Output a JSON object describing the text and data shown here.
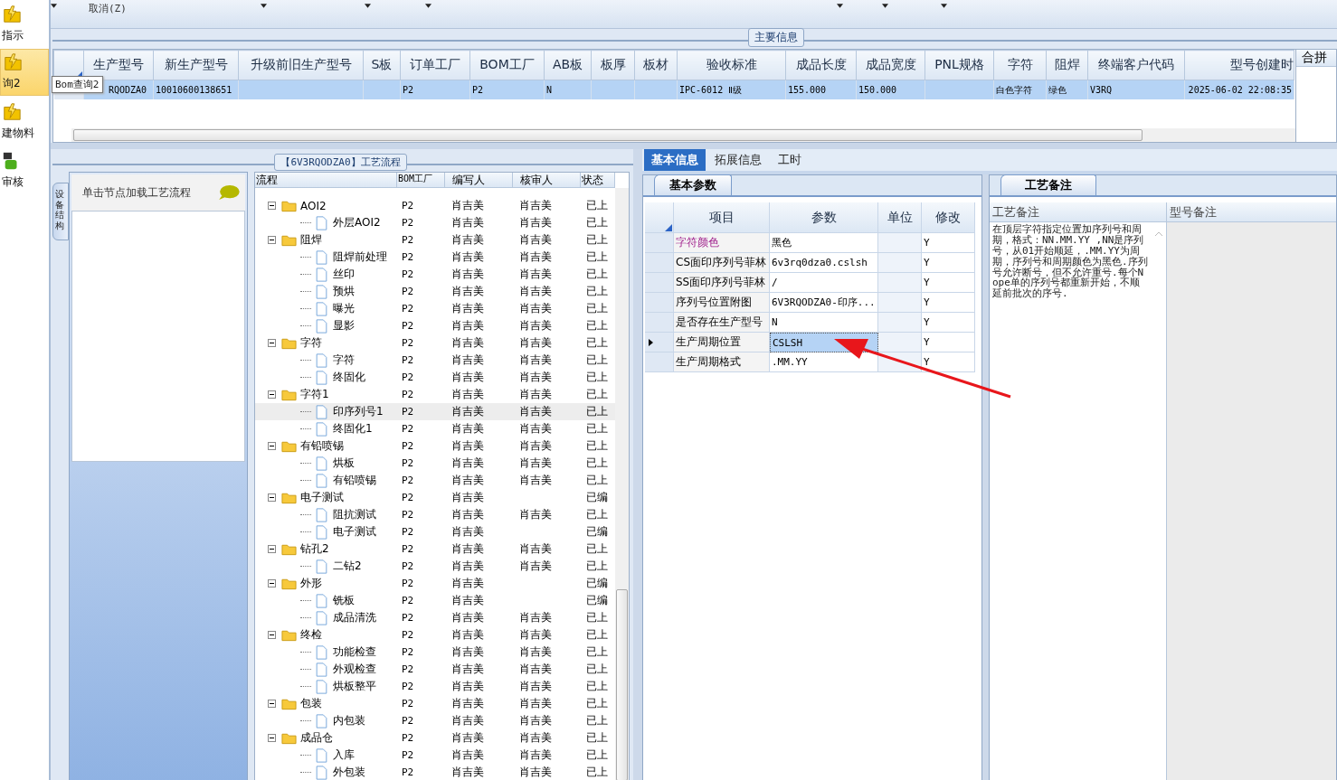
{
  "nav": [
    {
      "label": "指示",
      "selected": false
    },
    {
      "label": "询2",
      "selected": true
    },
    {
      "label": "建物料",
      "selected": false
    },
    {
      "label": "审核",
      "selected": false
    }
  ],
  "tooltip": "Bom查询2",
  "toolbar": {
    "cancel": "取消(Z)"
  },
  "main_info": {
    "title": "主要信息",
    "side_column": "合拼",
    "columns": [
      "生产型号",
      "新生产型号",
      "升级前旧生产型号",
      "S板",
      "订单工厂",
      "BOM工厂",
      "AB板",
      "板厚",
      "板材",
      "验收标准",
      "成品长度",
      "成品宽度",
      "PNL规格",
      "字符",
      "阻焊",
      "终端客户代码",
      "型号创建时"
    ],
    "rows": [
      {
        "selected": true,
        "cells": [
          "RQODZA0",
          "10010600138651",
          null,
          null,
          "P2",
          "P2",
          "N",
          null,
          null,
          "IPC-6012 Ⅱ级",
          "155.000",
          "150.000",
          null,
          "白色字符",
          "绿色",
          "V3RQ",
          "2025-06-02 22:08:35"
        ]
      }
    ]
  },
  "process": {
    "title": "【6V3RQODZA0】工艺流程",
    "side_tab": "设备结构",
    "hint": "单击节点加载工艺流程",
    "columns": [
      "流程",
      "BOM工厂",
      "编写人",
      "核审人",
      "状态"
    ],
    "tree": [
      {
        "name": "AOI2",
        "bom": "P2",
        "writer": "肖吉美",
        "reviewer": "肖吉美",
        "status": "已上",
        "expanded": true,
        "selected": false,
        "children": [
          {
            "name": "外层AOI2",
            "bom": "P2",
            "writer": "肖吉美",
            "reviewer": "肖吉美",
            "status": "已上",
            "selected": false
          }
        ]
      },
      {
        "name": "阻焊",
        "bom": "P2",
        "writer": "肖吉美",
        "reviewer": "肖吉美",
        "status": "已上",
        "expanded": true,
        "selected": false,
        "children": [
          {
            "name": "阻焊前处理",
            "bom": "P2",
            "writer": "肖吉美",
            "reviewer": "肖吉美",
            "status": "已上",
            "selected": false
          },
          {
            "name": "丝印",
            "bom": "P2",
            "writer": "肖吉美",
            "reviewer": "肖吉美",
            "status": "已上",
            "selected": false
          },
          {
            "name": "预烘",
            "bom": "P2",
            "writer": "肖吉美",
            "reviewer": "肖吉美",
            "status": "已上",
            "selected": false
          },
          {
            "name": "曝光",
            "bom": "P2",
            "writer": "肖吉美",
            "reviewer": "肖吉美",
            "status": "已上",
            "selected": false
          },
          {
            "name": "显影",
            "bom": "P2",
            "writer": "肖吉美",
            "reviewer": "肖吉美",
            "status": "已上",
            "selected": false
          }
        ]
      },
      {
        "name": "字符",
        "bom": "P2",
        "writer": "肖吉美",
        "reviewer": "肖吉美",
        "status": "已上",
        "expanded": true,
        "selected": false,
        "children": [
          {
            "name": "字符",
            "bom": "P2",
            "writer": "肖吉美",
            "reviewer": "肖吉美",
            "status": "已上",
            "selected": false
          },
          {
            "name": "终固化",
            "bom": "P2",
            "writer": "肖吉美",
            "reviewer": "肖吉美",
            "status": "已上",
            "selected": false
          }
        ]
      },
      {
        "name": "字符1",
        "bom": "P2",
        "writer": "肖吉美",
        "reviewer": "肖吉美",
        "status": "已上",
        "expanded": true,
        "selected": false,
        "children": [
          {
            "name": "印序列号1",
            "bom": "P2",
            "writer": "肖吉美",
            "reviewer": "肖吉美",
            "status": "已上",
            "selected": true
          },
          {
            "name": "终固化1",
            "bom": "P2",
            "writer": "肖吉美",
            "reviewer": "肖吉美",
            "status": "已上",
            "selected": false
          }
        ]
      },
      {
        "name": "有铅喷锡",
        "bom": "P2",
        "writer": "肖吉美",
        "reviewer": "肖吉美",
        "status": "已上",
        "expanded": true,
        "selected": false,
        "children": [
          {
            "name": "烘板",
            "bom": "P2",
            "writer": "肖吉美",
            "reviewer": "肖吉美",
            "status": "已上",
            "selected": false
          },
          {
            "name": "有铅喷锡",
            "bom": "P2",
            "writer": "肖吉美",
            "reviewer": "肖吉美",
            "status": "已上",
            "selected": false
          }
        ]
      },
      {
        "name": "电子测试",
        "bom": "P2",
        "writer": "肖吉美",
        "status": "已编",
        "expanded": true,
        "selected": false,
        "children": [
          {
            "name": "阻抗测试",
            "bom": "P2",
            "writer": "肖吉美",
            "reviewer": "肖吉美",
            "status": "已上",
            "selected": false
          },
          {
            "name": "电子测试",
            "bom": "P2",
            "writer": "肖吉美",
            "status": "已编",
            "selected": false
          }
        ]
      },
      {
        "name": "钻孔2",
        "bom": "P2",
        "writer": "肖吉美",
        "reviewer": "肖吉美",
        "status": "已上",
        "expanded": true,
        "selected": false,
        "children": [
          {
            "name": "二钻2",
            "bom": "P2",
            "writer": "肖吉美",
            "reviewer": "肖吉美",
            "status": "已上",
            "selected": false
          }
        ]
      },
      {
        "name": "外形",
        "bom": "P2",
        "writer": "肖吉美",
        "status": "已编",
        "expanded": true,
        "selected": false,
        "children": [
          {
            "name": "铣板",
            "bom": "P2",
            "writer": "肖吉美",
            "status": "已编",
            "selected": false
          },
          {
            "name": "成品清洗",
            "bom": "P2",
            "writer": "肖吉美",
            "reviewer": "肖吉美",
            "status": "已上",
            "selected": false
          }
        ]
      },
      {
        "name": "终检",
        "bom": "P2",
        "writer": "肖吉美",
        "reviewer": "肖吉美",
        "status": "已上",
        "expanded": true,
        "selected": false,
        "children": [
          {
            "name": "功能检查",
            "bom": "P2",
            "writer": "肖吉美",
            "reviewer": "肖吉美",
            "status": "已上",
            "selected": false
          },
          {
            "name": "外观检查",
            "bom": "P2",
            "writer": "肖吉美",
            "reviewer": "肖吉美",
            "status": "已上",
            "selected": false
          },
          {
            "name": "烘板整平",
            "bom": "P2",
            "writer": "肖吉美",
            "reviewer": "肖吉美",
            "status": "已上",
            "selected": false
          }
        ]
      },
      {
        "name": "包装",
        "bom": "P2",
        "writer": "肖吉美",
        "reviewer": "肖吉美",
        "status": "已上",
        "expanded": true,
        "selected": false,
        "children": [
          {
            "name": "内包装",
            "bom": "P2",
            "writer": "肖吉美",
            "reviewer": "肖吉美",
            "status": "已上",
            "selected": false
          }
        ]
      },
      {
        "name": "成品仓",
        "bom": "P2",
        "writer": "肖吉美",
        "reviewer": "肖吉美",
        "status": "已上",
        "expanded": true,
        "selected": false,
        "children": [
          {
            "name": "入库",
            "bom": "P2",
            "writer": "肖吉美",
            "reviewer": "肖吉美",
            "status": "已上",
            "selected": false
          },
          {
            "name": "外包装",
            "bom": "P2",
            "writer": "肖吉美",
            "reviewer": "肖吉美",
            "status": "已上",
            "selected": false
          }
        ]
      }
    ]
  },
  "detail": {
    "tabs": [
      {
        "label": "基本信息",
        "selected": true
      },
      {
        "label": "拓展信息",
        "selected": false
      },
      {
        "label": "工时",
        "selected": false
      }
    ],
    "sub_tab": "基本参数",
    "columns": [
      "项目",
      "参数",
      "单位",
      "修改"
    ],
    "rows": [
      {
        "item": "字符颜色",
        "highlighted": true,
        "value": "黑色",
        "modified": "Y",
        "selected": false
      },
      {
        "item": "CS面印序列号菲林",
        "highlighted": false,
        "value": "6v3rq0dza0.cslsh",
        "modified": "Y",
        "selected": false
      },
      {
        "item": "SS面印序列号菲林",
        "highlighted": false,
        "value": "/",
        "modified": "Y",
        "selected": false
      },
      {
        "item": "序列号位置附图",
        "highlighted": false,
        "value": "6V3RQODZA0-印序...",
        "modified": "Y",
        "selected": false
      },
      {
        "item": "是否存在生产型号",
        "highlighted": false,
        "value": "N",
        "modified": "Y",
        "selected": false
      },
      {
        "item": "生产周期位置",
        "highlighted": false,
        "value": "CSLSH",
        "modified": "Y",
        "selected": true
      },
      {
        "item": "生产周期格式",
        "highlighted": false,
        "value": ".MM.YY",
        "modified": "Y",
        "selected": false
      }
    ]
  },
  "notes": {
    "tab": "工艺备注",
    "columns": [
      "工艺备注",
      "型号备注"
    ],
    "text": "在顶层字符指定位置加序列号和周期，格式：NN.MM.YY ,NN是序列号，从01开始顺延，.MM.YY为周期，序列号和周期颜色为黑色.序列号允许断号，但不允许重号.每个Nope单的序列号都重新开始，不顺延前批次的序号."
  }
}
